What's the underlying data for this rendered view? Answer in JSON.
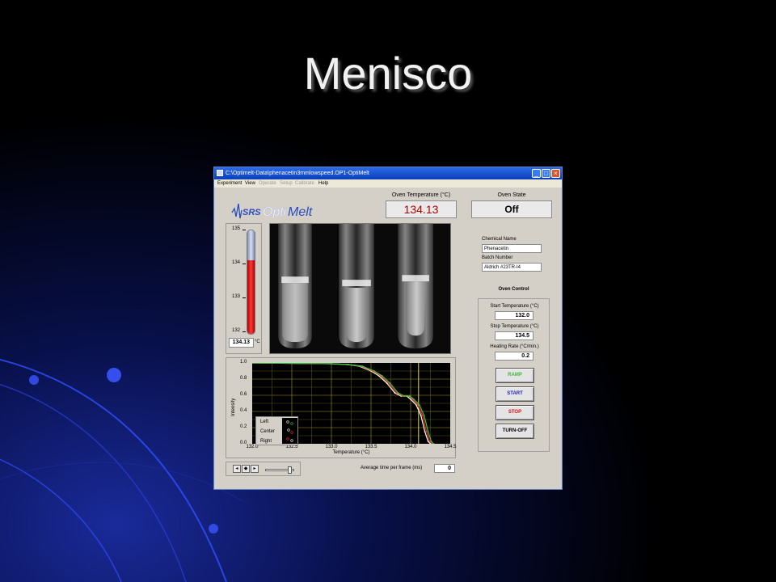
{
  "slide": {
    "title": "Menisco"
  },
  "window": {
    "title": "C:\\Optimelt-Data\\phenacetin3mmlowspeed.OP1-OptiMelt",
    "controls": {
      "minimize": "_",
      "maximize": "□",
      "close": "×"
    },
    "menu": [
      {
        "label": "Experiment",
        "enabled": true
      },
      {
        "label": "View",
        "enabled": true
      },
      {
        "label": "Operate",
        "enabled": false
      },
      {
        "label": "Setup",
        "enabled": false
      },
      {
        "label": "Calibrate",
        "enabled": false
      },
      {
        "label": "Help",
        "enabled": true
      }
    ]
  },
  "logo": {
    "brand": "SRS",
    "product_a": "Opti",
    "product_b": "Melt"
  },
  "oven_temperature": {
    "label": "Oven Temperature (°C)",
    "value": "134.13"
  },
  "oven_state": {
    "label": "Oven State",
    "value": "Off"
  },
  "thermometer": {
    "ticks": [
      "135",
      "134",
      "133",
      "132"
    ],
    "min": 132,
    "max": 135,
    "value": 134.13,
    "readout": "134.13",
    "unit": "°C"
  },
  "chemical": {
    "name_label": "Chemical Name",
    "name_value": "Phenacetin",
    "batch_label": "Batch Number",
    "batch_value": "Aldrich #23TR-I4"
  },
  "oven_control": {
    "label": "Oven Control",
    "start_label": "Start Temperature (°C)",
    "start_value": "132.0",
    "stop_label": "Stop Temperature (°C)",
    "stop_value": "134.5",
    "rate_label": "Heating Rate (°C/min.)",
    "rate_value": "0.2",
    "buttons": {
      "ramp": "RAMP",
      "start": "START",
      "stop": "STOP",
      "turnoff": "TURN-OFF"
    }
  },
  "plot_legend": {
    "left": "Left",
    "center": "Center",
    "right": "Right"
  },
  "frame_time": {
    "label": "Average time per frame (ms)",
    "value": "0"
  },
  "colors": {
    "accent_red": "#b00000",
    "ramp_text": "#3fb83f",
    "start_text": "#2020c0",
    "stop_text": "#d01010"
  },
  "chart_data": {
    "type": "line",
    "title": "",
    "xlabel": "Temperature (°C)",
    "ylabel": "Intensity",
    "xlim": [
      132.0,
      134.5
    ],
    "ylim": [
      0.0,
      1.0
    ],
    "xticks": [
      "132.0",
      "132.5",
      "133.0",
      "133.5",
      "134.0",
      "134.5"
    ],
    "yticks": [
      "0.0",
      "0.2",
      "0.4",
      "0.6",
      "0.8",
      "1.0"
    ],
    "grid": true,
    "vlines": [
      134.1
    ],
    "series": [
      {
        "color": "#ffffff",
        "x": [
          132.0,
          132.5,
          133.0,
          133.2,
          133.35,
          133.5,
          133.6,
          133.7,
          133.8,
          133.88,
          133.95,
          134.0,
          134.07,
          134.13,
          134.18,
          134.22,
          134.25
        ],
        "y": [
          1.0,
          0.995,
          0.99,
          0.98,
          0.96,
          0.9,
          0.84,
          0.75,
          0.63,
          0.59,
          0.59,
          0.55,
          0.48,
          0.35,
          0.15,
          0.03,
          0.0
        ]
      },
      {
        "color": "#ff2a2a",
        "x": [
          132.0,
          132.5,
          133.0,
          133.2,
          133.37,
          133.52,
          133.62,
          133.72,
          133.82,
          133.9,
          133.97,
          134.02,
          134.09,
          134.15,
          134.2,
          134.24,
          134.27
        ],
        "y": [
          1.0,
          0.995,
          0.99,
          0.98,
          0.96,
          0.9,
          0.84,
          0.75,
          0.63,
          0.59,
          0.59,
          0.55,
          0.48,
          0.35,
          0.15,
          0.03,
          0.0
        ]
      },
      {
        "color": "#2ecc40",
        "x": [
          132.0,
          132.5,
          133.0,
          133.22,
          133.39,
          133.54,
          133.64,
          133.74,
          133.84,
          133.92,
          133.99,
          134.04,
          134.11,
          134.17,
          134.22,
          134.26,
          134.29
        ],
        "y": [
          1.0,
          0.995,
          0.99,
          0.98,
          0.96,
          0.9,
          0.84,
          0.75,
          0.63,
          0.59,
          0.59,
          0.55,
          0.48,
          0.35,
          0.15,
          0.03,
          0.0
        ]
      }
    ]
  }
}
